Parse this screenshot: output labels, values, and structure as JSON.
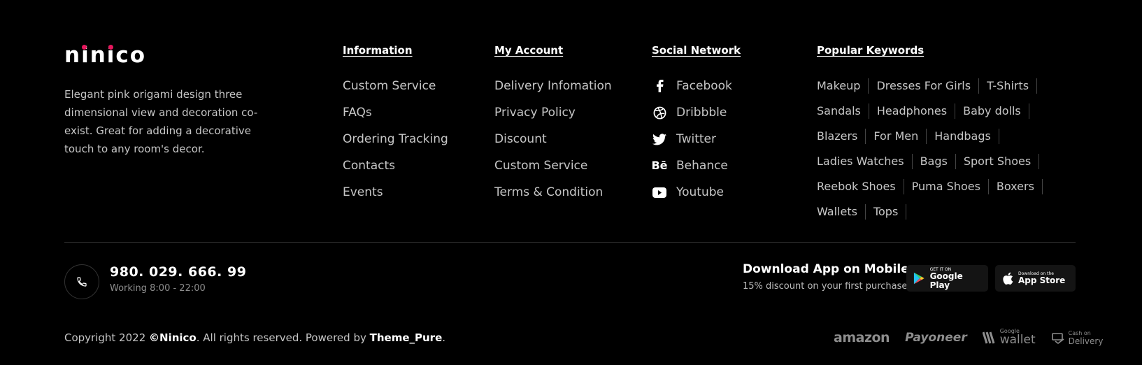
{
  "brand": {
    "logo_text": "ninico",
    "description": "Elegant pink origami design three dimensional view and decoration co-exist. Great for adding a decorative touch to any room's decor."
  },
  "information": {
    "title": "Information",
    "links": [
      "Custom Service",
      "FAQs",
      "Ordering Tracking",
      "Contacts",
      "Events"
    ]
  },
  "account": {
    "title": "My Account",
    "links": [
      "Delivery Infomation",
      "Privacy Policy",
      "Discount",
      "Custom Service",
      "Terms & Condition"
    ]
  },
  "social": {
    "title": "Social Network",
    "links": [
      {
        "label": "Facebook",
        "icon": "facebook-icon"
      },
      {
        "label": "Dribbble",
        "icon": "dribbble-icon"
      },
      {
        "label": "Twitter",
        "icon": "twitter-icon"
      },
      {
        "label": "Behance",
        "icon": "behance-icon"
      },
      {
        "label": "Youtube",
        "icon": "youtube-icon"
      }
    ]
  },
  "keywords": {
    "title": "Popular Keywords",
    "items": [
      "Makeup",
      "Dresses For Girls",
      "T-Shirts",
      "Sandals",
      "Headphones",
      "Baby dolls",
      "Blazers",
      "For Men",
      "Handbags",
      "Ladies Watches",
      "Bags",
      "Sport Shoes",
      "Reebok Shoes",
      "Puma Shoes",
      "Boxers",
      "Wallets",
      "Tops"
    ]
  },
  "contact": {
    "phone": "980. 029. 666. 99",
    "hours": "Working 8:00 - 22:00"
  },
  "app": {
    "title": "Download App on Mobile",
    "subtitle": "15% discount on your first purchase",
    "google_small": "GET IT ON",
    "google_big": "Google Play",
    "apple_small": "Download on the",
    "apple_big": "App Store"
  },
  "copyright": {
    "prefix": "Copyright 2022 ",
    "brand": "©Ninico",
    "middle": ". All rights reserved. Powered by ",
    "powered": "Theme_Pure",
    "suffix": "."
  },
  "payments": {
    "amazon": "amazon",
    "payoneer": "Payoneer",
    "wallet_small": "Google",
    "wallet": "wallet",
    "cod_top": "Cash on",
    "cod_bottom": "Delivery"
  },
  "colors": {
    "accent": "#e8175d",
    "background": "#000000"
  }
}
